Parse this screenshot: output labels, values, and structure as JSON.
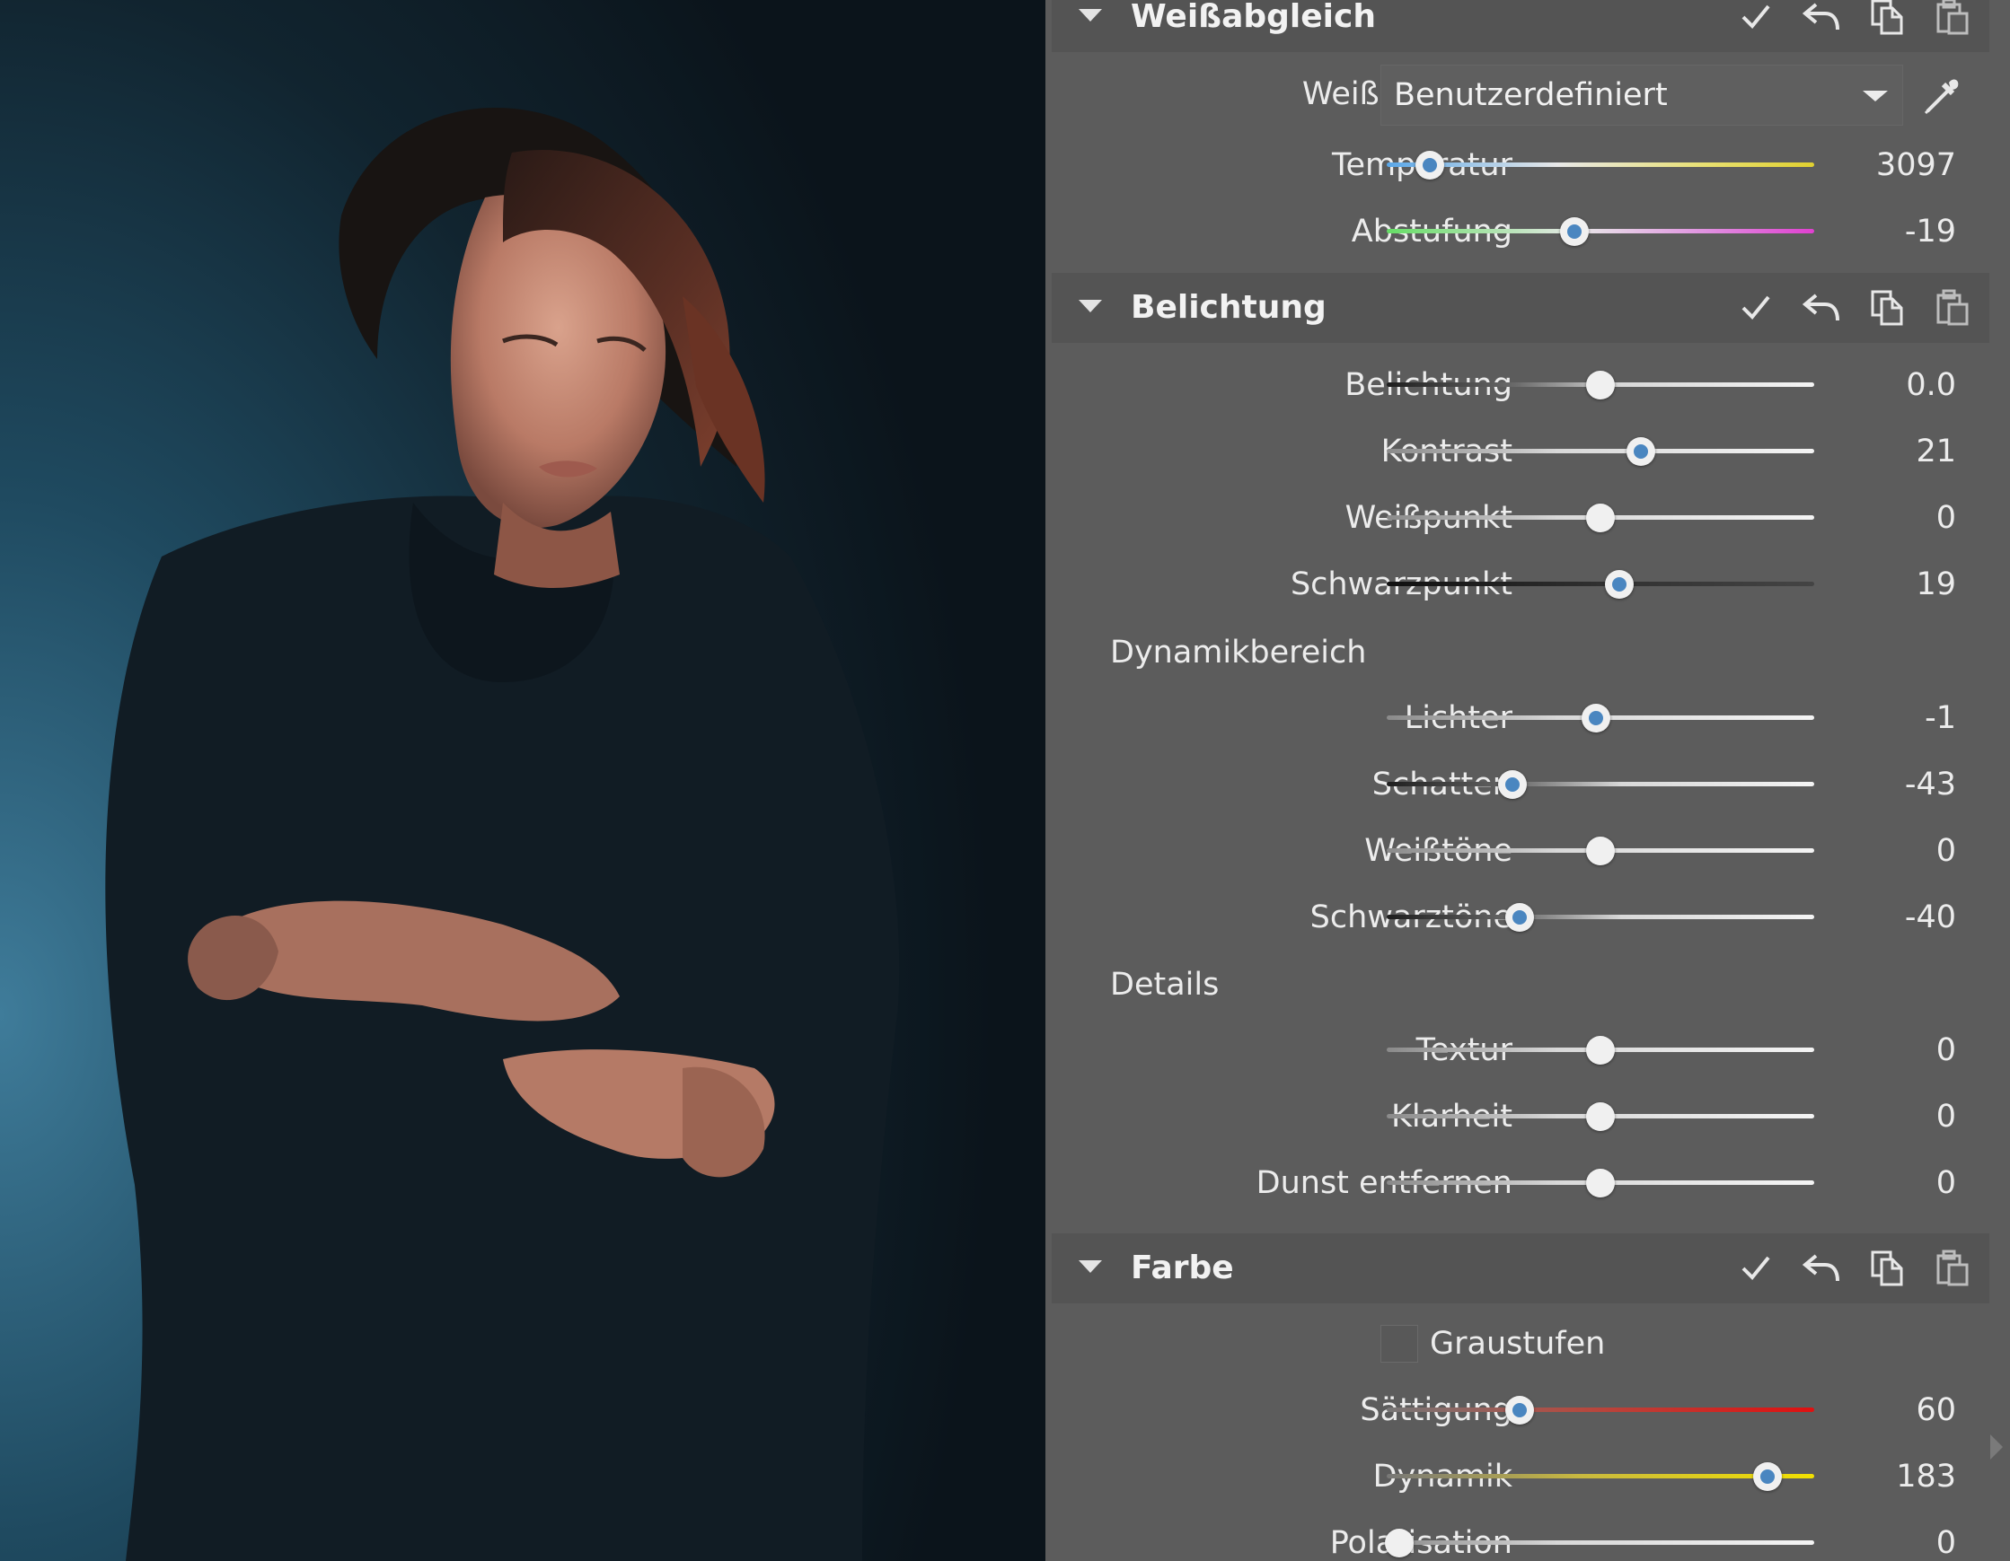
{
  "photo": {
    "description_icon": "portrait-photo"
  },
  "sections": [
    {
      "id": "wb",
      "title": "Weißabgleich",
      "rows": [
        {
          "label": "Temperatur",
          "value": "3097",
          "pos": 0.1,
          "knob": "blue",
          "track": "temp"
        },
        {
          "label": "Abstufung",
          "value": "-19",
          "pos": 0.44,
          "knob": "blue",
          "track": "tint"
        }
      ],
      "mode_label": "Weißabgleich",
      "mode_value": "Benutzerdefiniert"
    },
    {
      "id": "exposure",
      "title": "Belichtung",
      "rows": [
        {
          "label": "Belichtung",
          "value": "0.0",
          "pos": 0.5,
          "knob": "white",
          "track": "dark-left"
        },
        {
          "label": "Kontrast",
          "value": "21",
          "pos": 0.595,
          "knob": "blue",
          "track": "neutral"
        },
        {
          "label": "Weißpunkt",
          "value": "0",
          "pos": 0.5,
          "knob": "white",
          "track": "neutral"
        },
        {
          "label": "Schwarzpunkt",
          "value": "19",
          "pos": 0.545,
          "knob": "blue",
          "track": "black"
        }
      ],
      "sub1": "Dynamikbereich",
      "rows2": [
        {
          "label": "Lichter",
          "value": "-1",
          "pos": 0.49,
          "knob": "blue",
          "track": "neutral"
        },
        {
          "label": "Schatten",
          "value": "-43",
          "pos": 0.295,
          "knob": "blue",
          "track": "dark-left"
        },
        {
          "label": "Weißtöne",
          "value": "0",
          "pos": 0.5,
          "knob": "white",
          "track": "neutral"
        },
        {
          "label": "Schwarztöne",
          "value": "-40",
          "pos": 0.31,
          "knob": "blue",
          "track": "dark-left"
        }
      ],
      "sub2": "Details",
      "rows3": [
        {
          "label": "Textur",
          "value": "0",
          "pos": 0.5,
          "knob": "white",
          "track": "neutral"
        },
        {
          "label": "Klarheit",
          "value": "0",
          "pos": 0.5,
          "knob": "white",
          "track": "neutral"
        },
        {
          "label": "Dunst entfernen",
          "value": "0",
          "pos": 0.5,
          "knob": "white",
          "track": "neutral"
        }
      ]
    },
    {
      "id": "color",
      "title": "Farbe",
      "checkbox_label": "Graustufen",
      "rows": [
        {
          "label": "Sättigung",
          "value": "60",
          "pos": 0.31,
          "knob": "blue",
          "track": "red"
        },
        {
          "label": "Dynamik",
          "value": "183",
          "pos": 0.89,
          "knob": "blue",
          "track": "yellow"
        },
        {
          "label": "Polarisation",
          "value": "0",
          "pos": 0.03,
          "knob": "white",
          "track": "neutral"
        }
      ]
    }
  ],
  "header_icons": [
    "check-icon",
    "undo-icon",
    "copy-icon",
    "paste-icon"
  ]
}
